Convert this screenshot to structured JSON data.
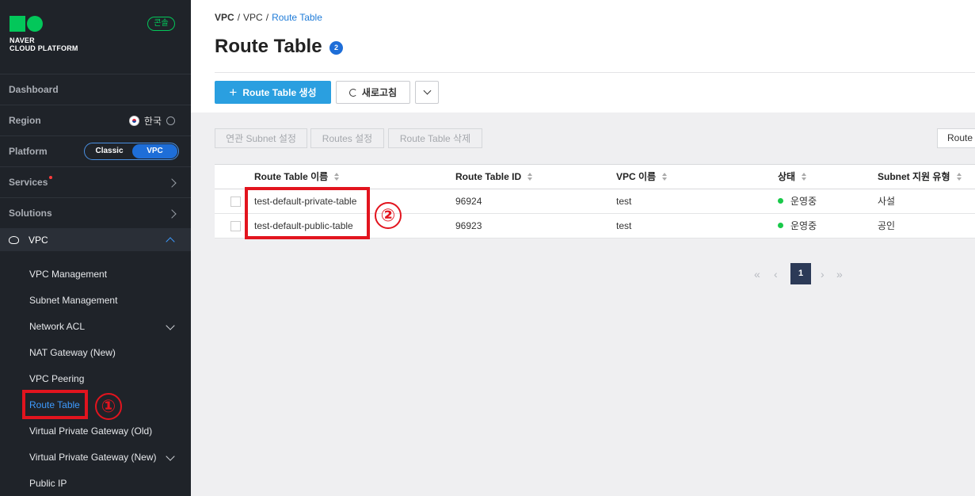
{
  "sidebar": {
    "logo": {
      "line1": "NAVER",
      "line2": "CLOUD PLATFORM"
    },
    "console_badge": "콘솔",
    "dashboard": "Dashboard",
    "region": {
      "label": "Region",
      "value": "한국"
    },
    "platform": {
      "label": "Platform",
      "classic": "Classic",
      "vpc": "VPC",
      "selected": "VPC"
    },
    "services": "Services",
    "solutions": "Solutions",
    "vpc": "VPC",
    "items": [
      {
        "label": "VPC Management",
        "expandable": false
      },
      {
        "label": "Subnet Management",
        "expandable": false
      },
      {
        "label": "Network ACL",
        "expandable": true
      },
      {
        "label": "NAT Gateway (New)",
        "expandable": false
      },
      {
        "label": "VPC Peering",
        "expandable": false
      },
      {
        "label": "Route Table",
        "expandable": false,
        "active": true
      },
      {
        "label": "Virtual Private Gateway (Old)",
        "expandable": false
      },
      {
        "label": "Virtual Private Gateway (New)",
        "expandable": true
      },
      {
        "label": "Public IP",
        "expandable": false
      }
    ]
  },
  "breadcrumb": [
    "VPC",
    "VPC",
    "Route Table"
  ],
  "page": {
    "title": "Route Table",
    "count": "2"
  },
  "toolbar": {
    "create": "Route Table 생성",
    "refresh": "새로고침"
  },
  "actions": {
    "subnet": "연관 Subnet 설정",
    "routes": "Routes 설정",
    "delete": "Route Table 삭제",
    "filter": "Route Table 이름"
  },
  "table": {
    "headers": [
      "Route Table 이름",
      "Route Table ID",
      "VPC 이름",
      "상태",
      "Subnet 지원 유형"
    ],
    "rows": [
      {
        "name": "test-default-private-table",
        "id": "96924",
        "vpc": "test",
        "status": "운영중",
        "type": "사설"
      },
      {
        "name": "test-default-public-table",
        "id": "96923",
        "vpc": "test",
        "status": "운영중",
        "type": "공인"
      }
    ]
  },
  "pagination": {
    "current": "1"
  },
  "annotations": {
    "one": "①",
    "two": "②"
  },
  "colors": {
    "primary": "#2a9fe0",
    "accent": "#1e6ed8",
    "annotation": "#e2141e",
    "status_ok": "#19c94a",
    "sidebar_bg": "#1f2329"
  }
}
